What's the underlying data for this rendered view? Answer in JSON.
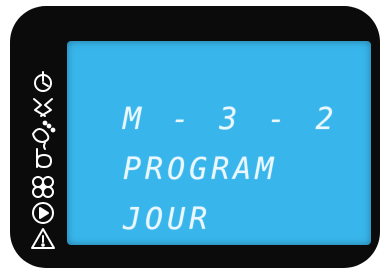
{
  "display": {
    "line1": "M - 3 - 2",
    "line2": "PROGRAM",
    "line3": "JOUR"
  },
  "colors": {
    "bezel": "#0b0b0b",
    "lcd_background": "#38b6ec",
    "segment": "#eaf7ff",
    "icon": "#ffffff"
  },
  "status_icons": [
    "power-timer-icon",
    "flash-icon",
    "water-spray-icon",
    "drying-icon",
    "fan-icon",
    "play-icon",
    "warning-icon"
  ]
}
